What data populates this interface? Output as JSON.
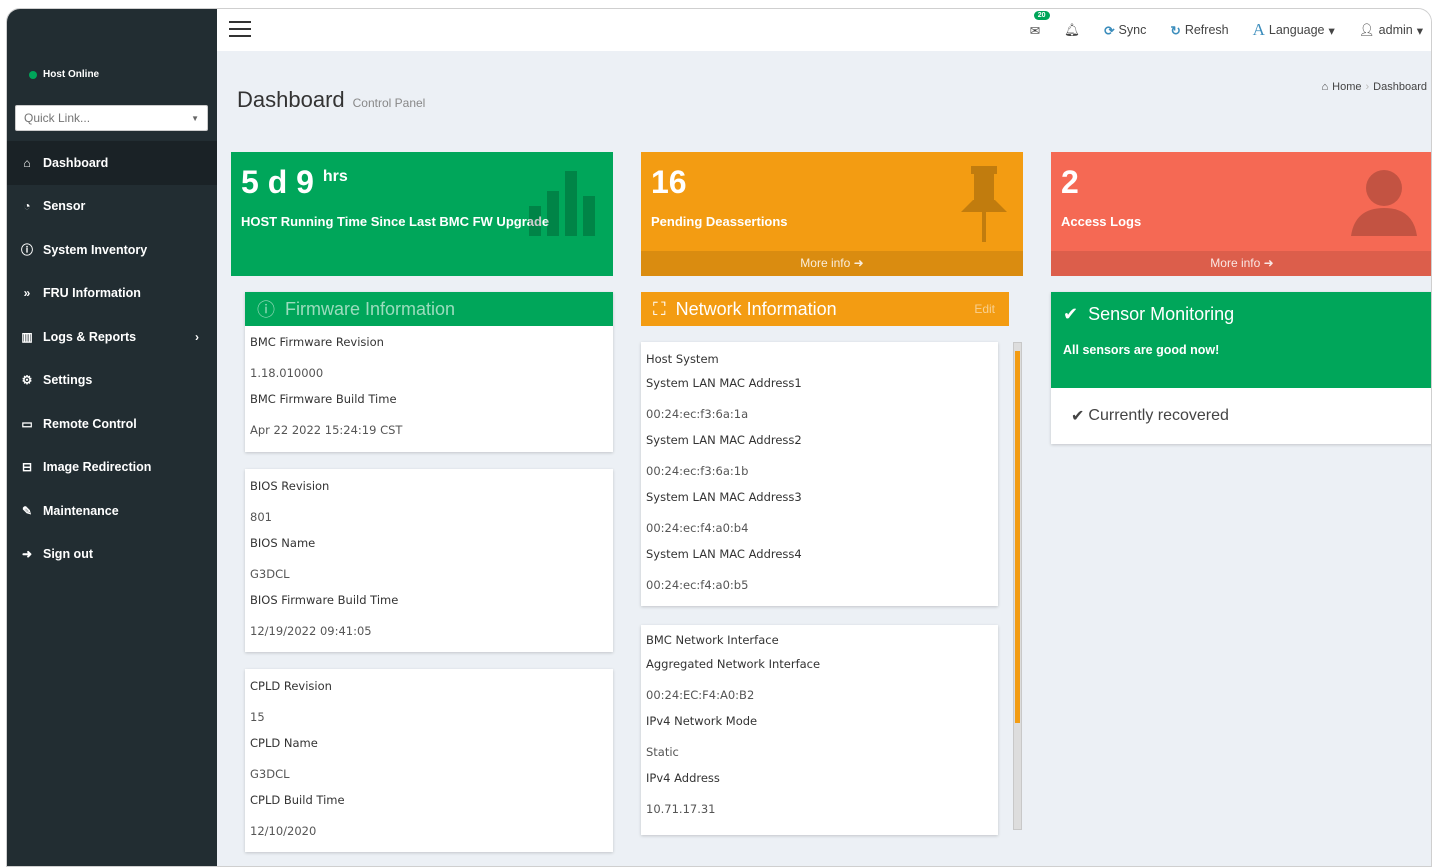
{
  "sidebar": {
    "host_status": "Host Online",
    "quicklink_placeholder": "Quick Link...",
    "items": [
      {
        "label": "Dashboard",
        "icon": "home-icon"
      },
      {
        "label": "Sensor",
        "icon": "dashboard-icon"
      },
      {
        "label": "System Inventory",
        "icon": "info-icon"
      },
      {
        "label": "FRU Information",
        "icon": "double-chevron-icon"
      },
      {
        "label": "Logs & Reports",
        "icon": "bar-chart-icon"
      },
      {
        "label": "Settings",
        "icon": "gear-icon"
      },
      {
        "label": "Remote Control",
        "icon": "monitor-icon"
      },
      {
        "label": "Image Redirection",
        "icon": "drive-icon"
      },
      {
        "label": "Maintenance",
        "icon": "wrench-icon"
      },
      {
        "label": "Sign out",
        "icon": "sign-out-icon"
      }
    ]
  },
  "topbar": {
    "messages_count": "20",
    "sync": "Sync",
    "refresh": "Refresh",
    "language": "Language",
    "user": "admin"
  },
  "header": {
    "title": "Dashboard",
    "subtitle": "Control Panel",
    "breadcrumb_home": "Home",
    "breadcrumb_current": "Dashboard"
  },
  "stats": {
    "uptime_value": "5 d 9",
    "uptime_unit": "hrs",
    "uptime_label": "HOST Running Time Since Last BMC FW Upgrade",
    "pending_value": "16",
    "pending_label": "Pending Deassertions",
    "pending_more": "More info",
    "access_value": "2",
    "access_label": "Access Logs",
    "access_more": "More info"
  },
  "firmware": {
    "title": "Firmware Information",
    "bmc_rev_label": "BMC Firmware Revision",
    "bmc_rev": "1.18.010000",
    "bmc_build_label": "BMC Firmware Build Time",
    "bmc_build": "Apr 22 2022 15:24:19 CST",
    "bios_rev_label": "BIOS Revision",
    "bios_rev": "801",
    "bios_name_label": "BIOS Name",
    "bios_name": "G3DCL",
    "bios_build_label": "BIOS Firmware Build Time",
    "bios_build": "12/19/2022 09:41:05",
    "cpld_rev_label": "CPLD Revision",
    "cpld_rev": "15",
    "cpld_name_label": "CPLD Name",
    "cpld_name": "G3DCL",
    "cpld_build_label": "CPLD Build Time",
    "cpld_build": "12/10/2020"
  },
  "network": {
    "title": "Network Information",
    "edit": "Edit",
    "host_system": "Host System",
    "mac1_label": "System LAN MAC Address1",
    "mac1": "00:24:ec:f3:6a:1a",
    "mac2_label": "System LAN MAC Address2",
    "mac2": "00:24:ec:f3:6a:1b",
    "mac3_label": "System LAN MAC Address3",
    "mac3": "00:24:ec:f4:a0:b4",
    "mac4_label": "System LAN MAC Address4",
    "mac4": "00:24:ec:f4:a0:b5",
    "bmc_if": "BMC Network Interface",
    "agg_label": "Aggregated Network Interface",
    "agg": "00:24:EC:F4:A0:B2",
    "mode_label": "IPv4 Network Mode",
    "mode": "Static",
    "ip_label": "IPv4 Address",
    "ip": "10.71.17.31"
  },
  "sensor": {
    "title": "Sensor Monitoring",
    "status": "All sensors are good now!",
    "recovered": "Currently recovered"
  },
  "colors": {
    "green": "#00a65a",
    "orange": "#f39c12",
    "red": "#f56954",
    "sidebar": "#222d32",
    "accent": "#3c8dbc"
  }
}
